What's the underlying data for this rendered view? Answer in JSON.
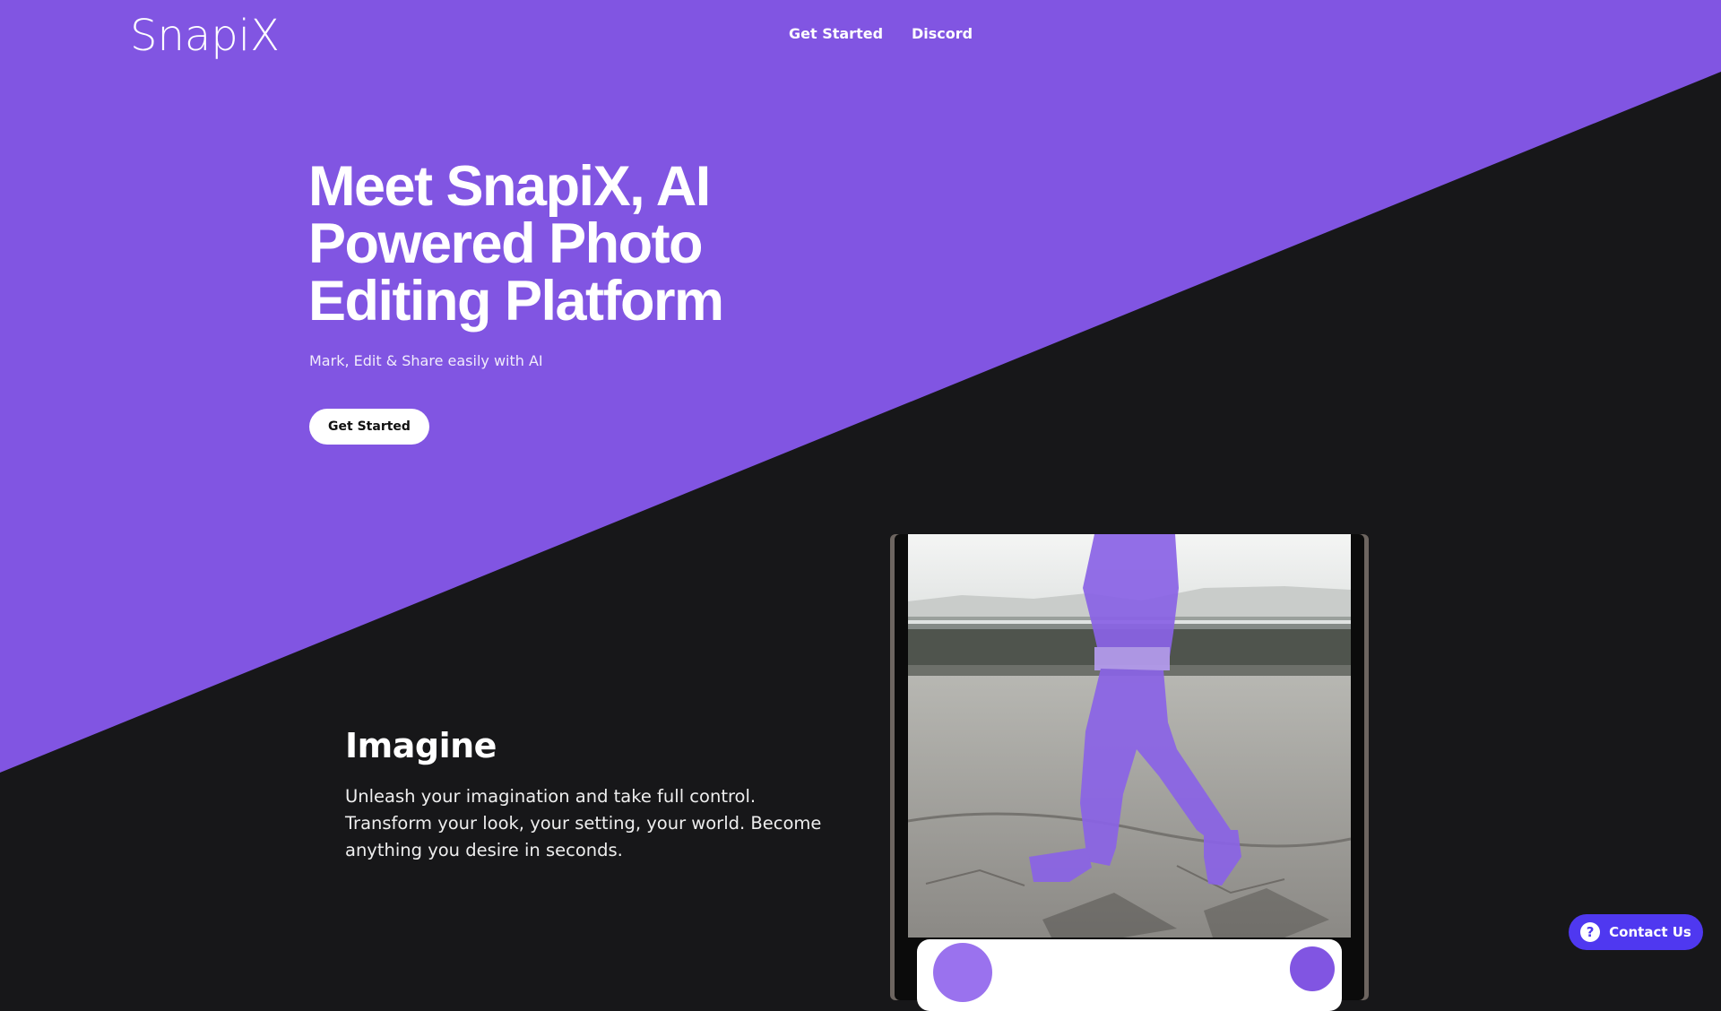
{
  "brand": {
    "logo": "SnapiX"
  },
  "nav": {
    "links": [
      "Get Started",
      "Discord"
    ]
  },
  "hero": {
    "title": "Meet SnapiX, AI Powered Photo Editing Platform",
    "subtitle": "Mark, Edit & Share easily with AI",
    "cta": "Get Started"
  },
  "feature": {
    "title": "Imagine",
    "text": "Unleash your imagination and take full control. Transform your look, your setting, your world. Become anything you desire in seconds."
  },
  "contact": {
    "label": "Contact Us",
    "icon": "question-icon"
  },
  "colors": {
    "brand": "#8155e2",
    "dark": "#171719",
    "contact": "#4f38f0"
  }
}
